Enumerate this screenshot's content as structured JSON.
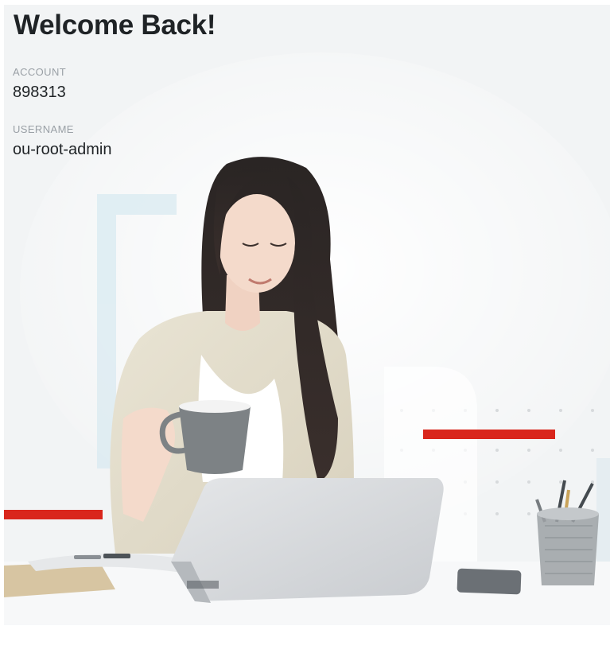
{
  "header": {
    "title": "Welcome Back!"
  },
  "account": {
    "label": "ACCOUNT",
    "value": "898313"
  },
  "user": {
    "label": "USERNAME",
    "value": "ou-root-admin"
  },
  "colors": {
    "accent_red": "#d9261c",
    "panel_bg": "#f2f4f5",
    "heading": "#1f2326",
    "label": "#9aa0a6"
  }
}
